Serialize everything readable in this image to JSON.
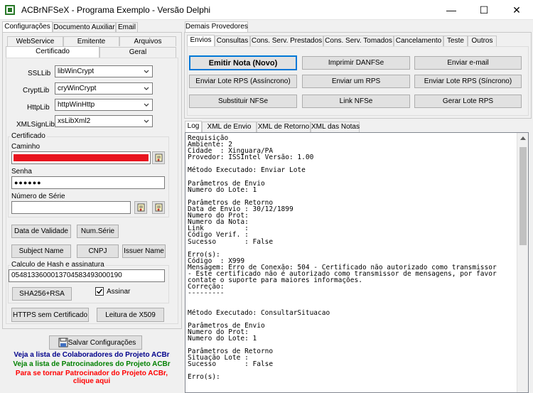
{
  "window": {
    "title": "ACBrNFSeX - Programa Exemplo - Versão Delphi",
    "minimize": "—",
    "maximize": "☐",
    "close": "✕"
  },
  "left_tabs": [
    "Configurações",
    "Documento Auxiliar",
    "Email"
  ],
  "config_tabs_row1": [
    "WebService",
    "Emitente",
    "Arquivos"
  ],
  "config_tabs_row2": [
    "Certificado",
    "Geral"
  ],
  "certificado": {
    "ssllib_label": "SSLLib",
    "ssllib_value": "libWinCrypt",
    "cryptlib_label": "CryptLib",
    "cryptlib_value": "cryWinCrypt",
    "httplib_label": "HttpLib",
    "httplib_value": "httpWinHttp",
    "xmlsignlib_label": "XMLSignLib",
    "xmlsignlib_value": "xsLibXml2",
    "group_title": "Certificado",
    "caminho_label": "Caminho",
    "senha_label": "Senha",
    "senha_value": "●●●●●●",
    "numero_serie_label": "Número de Série",
    "numero_serie_value": "",
    "btn_data_validade": "Data de Validade",
    "btn_num_serie": "Num.Série",
    "btn_subject_name": "Subject Name",
    "btn_cnpj": "CNPJ",
    "btn_issuer_name": "Issuer Name",
    "hash_group_title": "Calculo de Hash e assinatura",
    "hash_value": "05481336000137045834930001​90",
    "btn_sha256": "SHA256+RSA",
    "assinar_label": "Assinar",
    "assinar_checked": true,
    "btn_https_sem_cert": "HTTPS sem Certificado",
    "btn_leitura_x509": "Leitura de X509"
  },
  "footer": {
    "btn_salvar": "Salvar Configurações",
    "link_colaboradores": "Veja a lista de Colaboradores do Projeto ACBr",
    "link_patrocinadores": "Veja a lista de Patrocinadores do Projeto ACBr",
    "link_patrocinador_1": "Para se tornar Patrocinador do Projeto ACBr,",
    "link_patrocinador_2": "clique aqui",
    "colors": {
      "blue": "#00008b",
      "green": "#008000",
      "red": "#ff0000"
    }
  },
  "right_top_tab": "Demais Provedores",
  "right_tabs": [
    "Envios",
    "Consultas",
    "Cons. Serv. Prestados",
    "Cons. Serv. Tomados",
    "Cancelamento",
    "Teste",
    "Outros"
  ],
  "envios_buttons": {
    "emitir_nota": "Emitir Nota (Novo)",
    "imprimir_danfse": "Imprimir DANFSe",
    "enviar_email": "Enviar e-mail",
    "enviar_lote_assincrono": "Enviar Lote RPS (Assíncrono)",
    "enviar_um_rps": "Enviar um RPS",
    "enviar_lote_sincrono": "Enviar Lote RPS (Síncrono)",
    "substituir_nfse": "Substituir NFSe",
    "link_nfse": "Link NFSe",
    "gerar_lote_rps": "Gerar Lote RPS"
  },
  "log_tabs": [
    "Log",
    "XML de Envio",
    "XML de Retorno",
    "XML das Notas"
  ],
  "log_text": "Requisição\nAmbiente: 2\nCidade  : Xinguara/PA\nProvedor: ISSIntel Versão: 1.00\n\nMétodo Executado: Enviar Lote\n\nParâmetros de Envio\nNumero do Lote: 1\n\nParâmetros de Retorno\nData de Envio : 30/12/1899\nNumero do Prot:\nNumero da Nota:\nLink          :\nCódigo Verif. :\nSucesso       : False\n\nErro(s):\nCódigo  : X999\nMensagem: Erro de Conexão: 504 - Certificado não autorizado como transmissor\n- Este certificado não é autorizado como transmissor de mensagens, por favor\ncontate o suporte para maiores informações.\nCorreção:\n---------\n\n\nMétodo Executado: ConsultarSituacao\n\nParâmetros de Envio\nNumero do Prot:\nNumero do Lote: 1\n\nParâmetros de Retorno\nSituação Lote :\nSucesso       : False\n\nErro(s):"
}
